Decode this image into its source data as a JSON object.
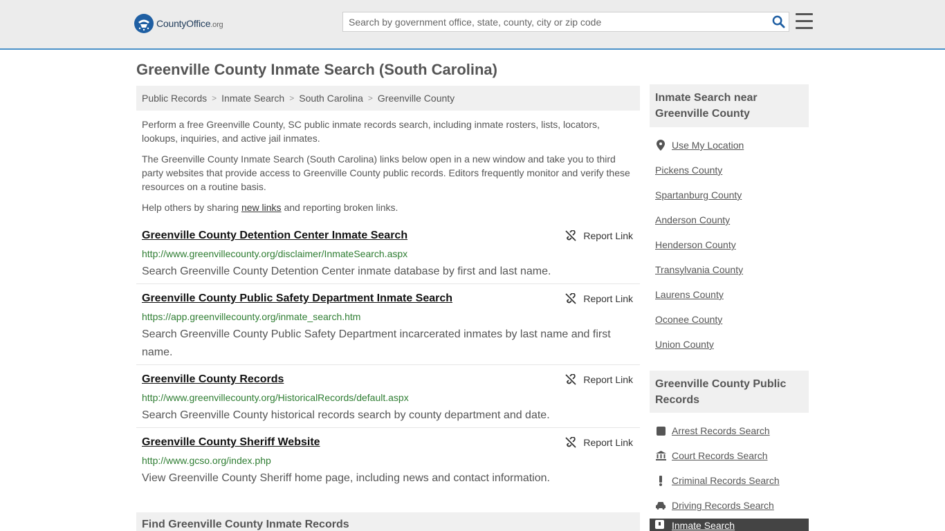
{
  "header": {
    "logo_county": "County",
    "logo_office": "Office",
    "logo_org": ".org",
    "search_placeholder": "Search by government office, state, county, city or zip code"
  },
  "page_title": "Greenville County Inmate Search (South Carolina)",
  "breadcrumb": [
    "Public Records",
    "Inmate Search",
    "South Carolina",
    "Greenville County"
  ],
  "intro": {
    "p1": "Perform a free Greenville County, SC public inmate records search, including inmate rosters, lists, locators, lookups, inquiries, and active jail inmates.",
    "p2": "The Greenville County Inmate Search (South Carolina) links below open in a new window and take you to third party websites that provide access to Greenville County public records. Editors frequently monitor and verify these resources on a routine basis.",
    "p3_before": "Help others by sharing ",
    "p3_link": "new links",
    "p3_after": " and reporting broken links."
  },
  "report_label": "Report Link",
  "listings": [
    {
      "title": "Greenville County Detention Center Inmate Search",
      "url": "http://www.greenvillecounty.org/disclaimer/InmateSearch.aspx",
      "desc": "Search Greenville County Detention Center inmate database by first and last name."
    },
    {
      "title": "Greenville County Public Safety Department Inmate Search",
      "url": "https://app.greenvillecounty.org/inmate_search.htm",
      "desc": "Search Greenville County Public Safety Department incarcerated inmates by last name and first name."
    },
    {
      "title": "Greenville County Records",
      "url": "http://www.greenvillecounty.org/HistoricalRecords/default.aspx",
      "desc": "Search Greenville County historical records search by county department and date."
    },
    {
      "title": "Greenville County Sheriff Website",
      "url": "http://www.gcso.org/index.php",
      "desc": "View Greenville County Sheriff home page, including news and contact information."
    }
  ],
  "find_heading": "Find Greenville County Inmate Records",
  "sidebar": {
    "near_heading": "Inmate Search near Greenville County",
    "use_location": "Use My Location",
    "near_counties": [
      "Pickens County",
      "Spartanburg County",
      "Anderson County",
      "Henderson County",
      "Transylvania County",
      "Laurens County",
      "Oconee County",
      "Union County"
    ],
    "records_heading": "Greenville County Public Records",
    "records_links": [
      {
        "label": "Arrest Records Search",
        "icon": "square-icon"
      },
      {
        "label": "Court Records Search",
        "icon": "courthouse-icon"
      },
      {
        "label": "Criminal Records Search",
        "icon": "exclamation-icon"
      },
      {
        "label": "Driving Records Search",
        "icon": "car-icon"
      }
    ],
    "active_link": "Inmate Search"
  }
}
